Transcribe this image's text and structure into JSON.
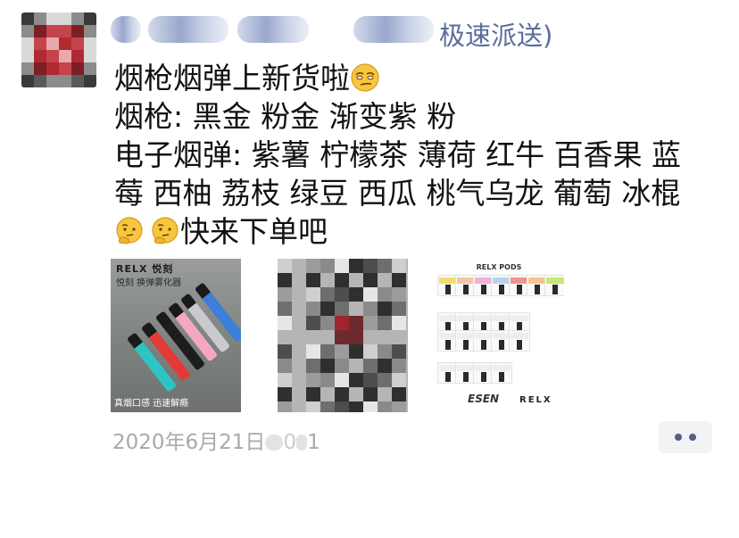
{
  "header": {
    "user_name_visible": "极速派送)"
  },
  "post": {
    "lines": [
      "烟枪烟弹上新货啦",
      "烟枪: 黑金 粉金 渐变紫 粉",
      "电子烟弹: 紫薯 柠檬茶 薄荷 红牛 百香果 蓝",
      "莓 西柚 荔枝 绿豆 西瓜 桃气乌龙 葡萄 冰棍",
      "快来下单吧"
    ],
    "emojis": [
      "smirk-emoji",
      "thinking-emoji",
      "thinking-emoji"
    ]
  },
  "images": [
    {
      "brand_line1": "RELX 悦刻",
      "brand_line2": "悦刻 换弹雾化器",
      "caption": "真烟口感 迅速解瘾"
    },
    {
      "blurred": true
    },
    {
      "title": "RELX PODS",
      "logo_left": "ESEN",
      "logo_right": "RELX"
    }
  ],
  "timestamp": {
    "text": "2020年6月21日",
    "tail": "1"
  },
  "more_icon": "more-dots-icon",
  "colors": {
    "name": "#5a6c9c",
    "time": "#a9a9a9",
    "more_dot": "#54607f"
  }
}
